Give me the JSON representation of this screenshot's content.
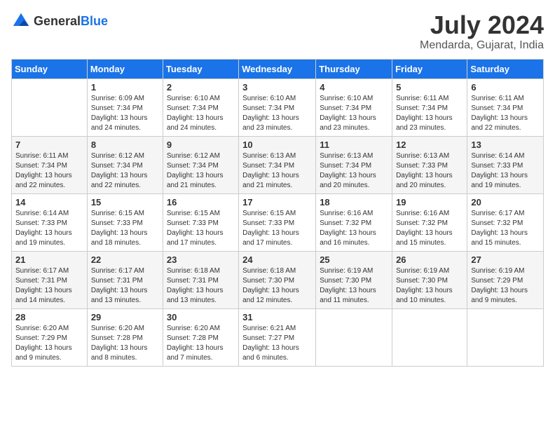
{
  "header": {
    "logo_general": "General",
    "logo_blue": "Blue",
    "month": "July 2024",
    "location": "Mendarda, Gujarat, India"
  },
  "days_of_week": [
    "Sunday",
    "Monday",
    "Tuesday",
    "Wednesday",
    "Thursday",
    "Friday",
    "Saturday"
  ],
  "weeks": [
    {
      "cells": [
        {
          "day": null
        },
        {
          "day": "1",
          "sunrise": "6:09 AM",
          "sunset": "7:34 PM",
          "daylight": "13 hours and 24 minutes."
        },
        {
          "day": "2",
          "sunrise": "6:10 AM",
          "sunset": "7:34 PM",
          "daylight": "13 hours and 24 minutes."
        },
        {
          "day": "3",
          "sunrise": "6:10 AM",
          "sunset": "7:34 PM",
          "daylight": "13 hours and 23 minutes."
        },
        {
          "day": "4",
          "sunrise": "6:10 AM",
          "sunset": "7:34 PM",
          "daylight": "13 hours and 23 minutes."
        },
        {
          "day": "5",
          "sunrise": "6:11 AM",
          "sunset": "7:34 PM",
          "daylight": "13 hours and 23 minutes."
        },
        {
          "day": "6",
          "sunrise": "6:11 AM",
          "sunset": "7:34 PM",
          "daylight": "13 hours and 22 minutes."
        }
      ]
    },
    {
      "cells": [
        {
          "day": "7",
          "sunrise": "6:11 AM",
          "sunset": "7:34 PM",
          "daylight": "13 hours and 22 minutes."
        },
        {
          "day": "8",
          "sunrise": "6:12 AM",
          "sunset": "7:34 PM",
          "daylight": "13 hours and 22 minutes."
        },
        {
          "day": "9",
          "sunrise": "6:12 AM",
          "sunset": "7:34 PM",
          "daylight": "13 hours and 21 minutes."
        },
        {
          "day": "10",
          "sunrise": "6:13 AM",
          "sunset": "7:34 PM",
          "daylight": "13 hours and 21 minutes."
        },
        {
          "day": "11",
          "sunrise": "6:13 AM",
          "sunset": "7:34 PM",
          "daylight": "13 hours and 20 minutes."
        },
        {
          "day": "12",
          "sunrise": "6:13 AM",
          "sunset": "7:33 PM",
          "daylight": "13 hours and 20 minutes."
        },
        {
          "day": "13",
          "sunrise": "6:14 AM",
          "sunset": "7:33 PM",
          "daylight": "13 hours and 19 minutes."
        }
      ]
    },
    {
      "cells": [
        {
          "day": "14",
          "sunrise": "6:14 AM",
          "sunset": "7:33 PM",
          "daylight": "13 hours and 19 minutes."
        },
        {
          "day": "15",
          "sunrise": "6:15 AM",
          "sunset": "7:33 PM",
          "daylight": "13 hours and 18 minutes."
        },
        {
          "day": "16",
          "sunrise": "6:15 AM",
          "sunset": "7:33 PM",
          "daylight": "13 hours and 17 minutes."
        },
        {
          "day": "17",
          "sunrise": "6:15 AM",
          "sunset": "7:33 PM",
          "daylight": "13 hours and 17 minutes."
        },
        {
          "day": "18",
          "sunrise": "6:16 AM",
          "sunset": "7:32 PM",
          "daylight": "13 hours and 16 minutes."
        },
        {
          "day": "19",
          "sunrise": "6:16 AM",
          "sunset": "7:32 PM",
          "daylight": "13 hours and 15 minutes."
        },
        {
          "day": "20",
          "sunrise": "6:17 AM",
          "sunset": "7:32 PM",
          "daylight": "13 hours and 15 minutes."
        }
      ]
    },
    {
      "cells": [
        {
          "day": "21",
          "sunrise": "6:17 AM",
          "sunset": "7:31 PM",
          "daylight": "13 hours and 14 minutes."
        },
        {
          "day": "22",
          "sunrise": "6:17 AM",
          "sunset": "7:31 PM",
          "daylight": "13 hours and 13 minutes."
        },
        {
          "day": "23",
          "sunrise": "6:18 AM",
          "sunset": "7:31 PM",
          "daylight": "13 hours and 13 minutes."
        },
        {
          "day": "24",
          "sunrise": "6:18 AM",
          "sunset": "7:30 PM",
          "daylight": "13 hours and 12 minutes."
        },
        {
          "day": "25",
          "sunrise": "6:19 AM",
          "sunset": "7:30 PM",
          "daylight": "13 hours and 11 minutes."
        },
        {
          "day": "26",
          "sunrise": "6:19 AM",
          "sunset": "7:30 PM",
          "daylight": "13 hours and 10 minutes."
        },
        {
          "day": "27",
          "sunrise": "6:19 AM",
          "sunset": "7:29 PM",
          "daylight": "13 hours and 9 minutes."
        }
      ]
    },
    {
      "cells": [
        {
          "day": "28",
          "sunrise": "6:20 AM",
          "sunset": "7:29 PM",
          "daylight": "13 hours and 9 minutes."
        },
        {
          "day": "29",
          "sunrise": "6:20 AM",
          "sunset": "7:28 PM",
          "daylight": "13 hours and 8 minutes."
        },
        {
          "day": "30",
          "sunrise": "6:20 AM",
          "sunset": "7:28 PM",
          "daylight": "13 hours and 7 minutes."
        },
        {
          "day": "31",
          "sunrise": "6:21 AM",
          "sunset": "7:27 PM",
          "daylight": "13 hours and 6 minutes."
        },
        {
          "day": null
        },
        {
          "day": null
        },
        {
          "day": null
        }
      ]
    }
  ],
  "labels": {
    "sunrise": "Sunrise:",
    "sunset": "Sunset:",
    "daylight": "Daylight hours"
  }
}
